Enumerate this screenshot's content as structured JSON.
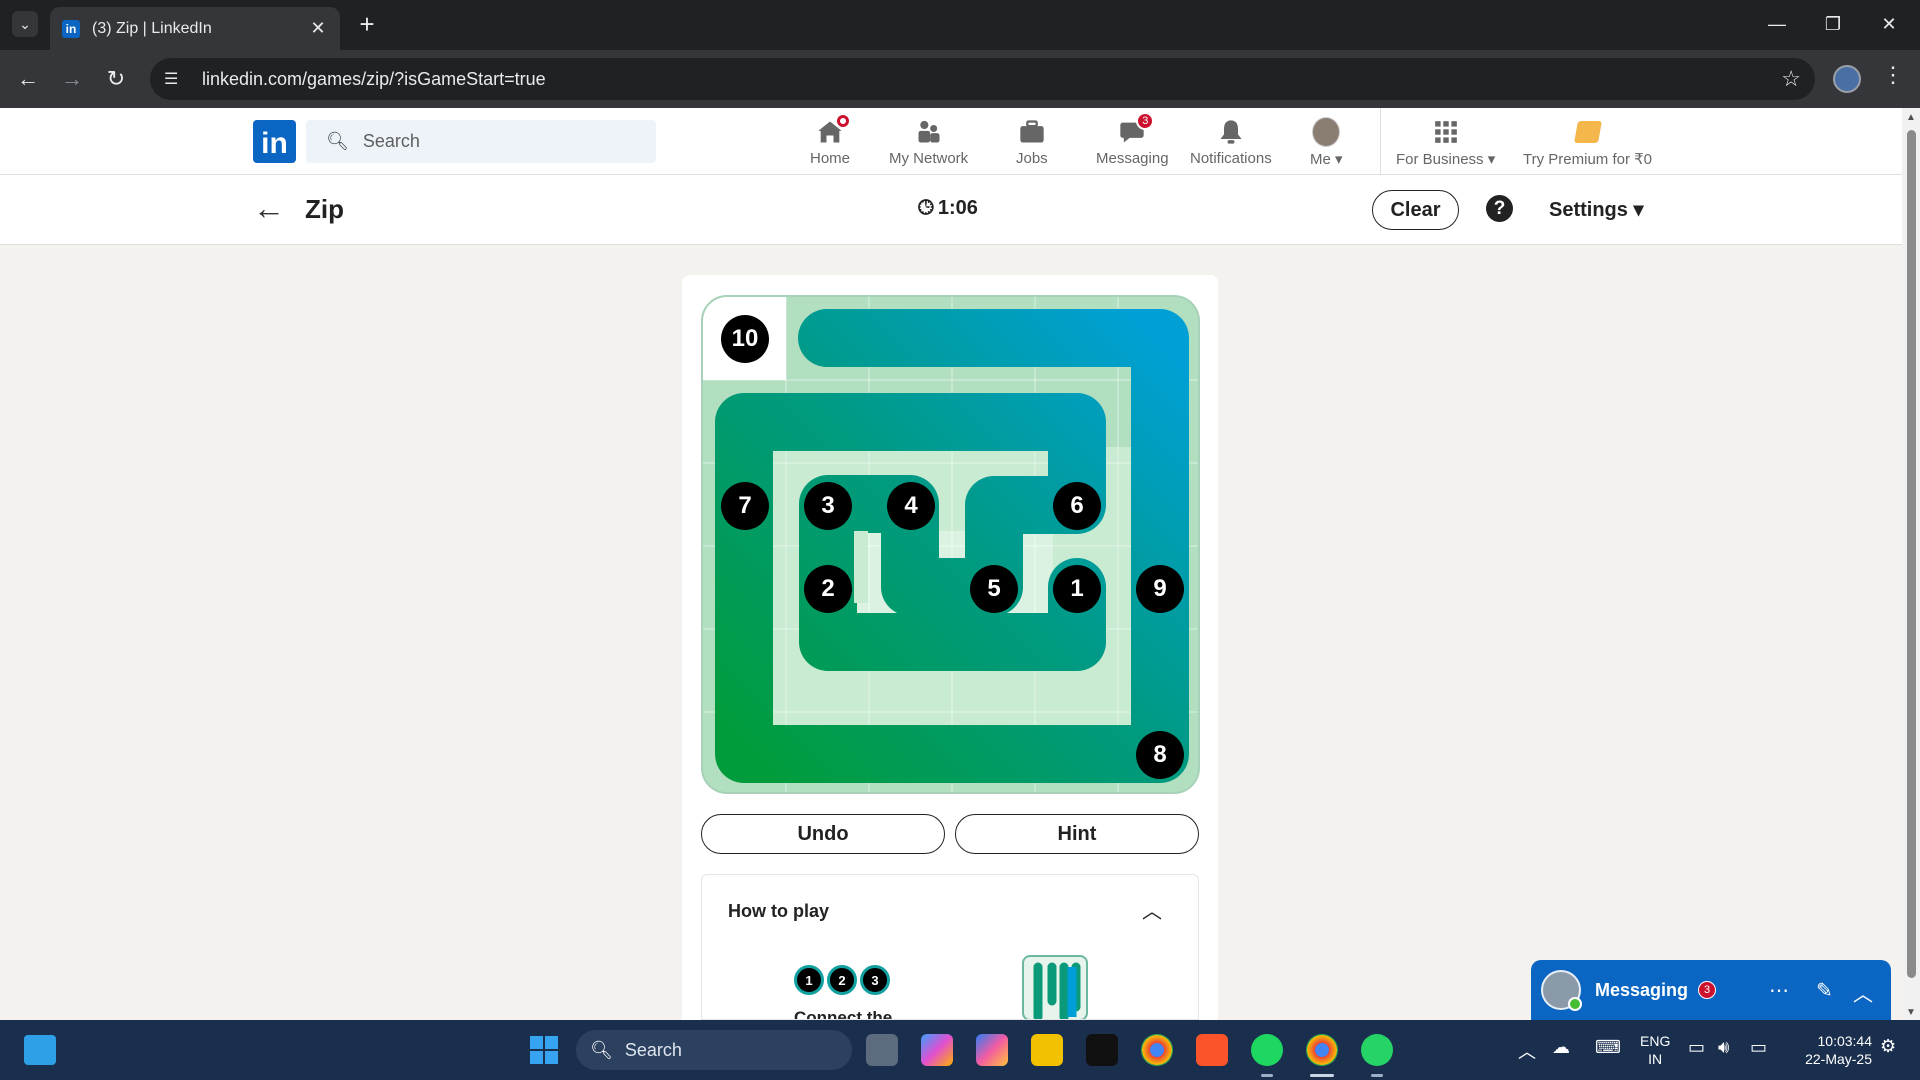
{
  "browser": {
    "tab_title": "(3) Zip | LinkedIn",
    "tab_favicon": "in",
    "new_tab": "+",
    "close_tab": "✕",
    "url": "linkedin.com/games/zip/?isGameStart=true"
  },
  "linkedin": {
    "logo": "in",
    "search_placeholder": "Search",
    "nav": [
      {
        "label": "Home",
        "icon": "home-icon"
      },
      {
        "label": "My Network",
        "icon": "network-icon"
      },
      {
        "label": "Jobs",
        "icon": "briefcase-icon"
      },
      {
        "label": "Messaging",
        "icon": "messaging-icon",
        "badge": "3"
      },
      {
        "label": "Notifications",
        "icon": "bell-icon"
      },
      {
        "label": "Me",
        "icon": "avatar"
      },
      {
        "label": "For Business",
        "icon": "grid-icon"
      },
      {
        "label": "Try Premium for ₹0",
        "icon": "premium-icon"
      }
    ]
  },
  "game": {
    "title": "Zip",
    "timer": "1:06",
    "clear_label": "Clear",
    "help_label": "?",
    "settings_label": "Settings",
    "undo_label": "Undo",
    "hint_label": "Hint",
    "how_to_play": "How to play",
    "howto_caption": "Connect the",
    "howto_dots": [
      "1",
      "2",
      "3"
    ],
    "grid_size": 6,
    "numbers": [
      {
        "label": "10",
        "row": 0,
        "col": 0
      },
      {
        "label": "7",
        "row": 2,
        "col": 0
      },
      {
        "label": "3",
        "row": 2,
        "col": 1
      },
      {
        "label": "4",
        "row": 2,
        "col": 2
      },
      {
        "label": "6",
        "row": 2,
        "col": 4
      },
      {
        "label": "2",
        "row": 3,
        "col": 1
      },
      {
        "label": "5",
        "row": 3,
        "col": 3
      },
      {
        "label": "1",
        "row": 3,
        "col": 4
      },
      {
        "label": "9",
        "row": 3,
        "col": 5
      },
      {
        "label": "8",
        "row": 5,
        "col": 5
      }
    ],
    "path_colors": {
      "board_bg": "#b1dfc0",
      "path_start": "#009c3b",
      "path_mid": "#009a80",
      "path_end": "#00a0d6"
    }
  },
  "messaging": {
    "title": "Messaging",
    "badge": "3"
  },
  "taskbar": {
    "search_label": "Search",
    "lang_top": "ENG",
    "lang_bottom": "IN",
    "time": "10:03:44",
    "date": "22-May-25"
  }
}
